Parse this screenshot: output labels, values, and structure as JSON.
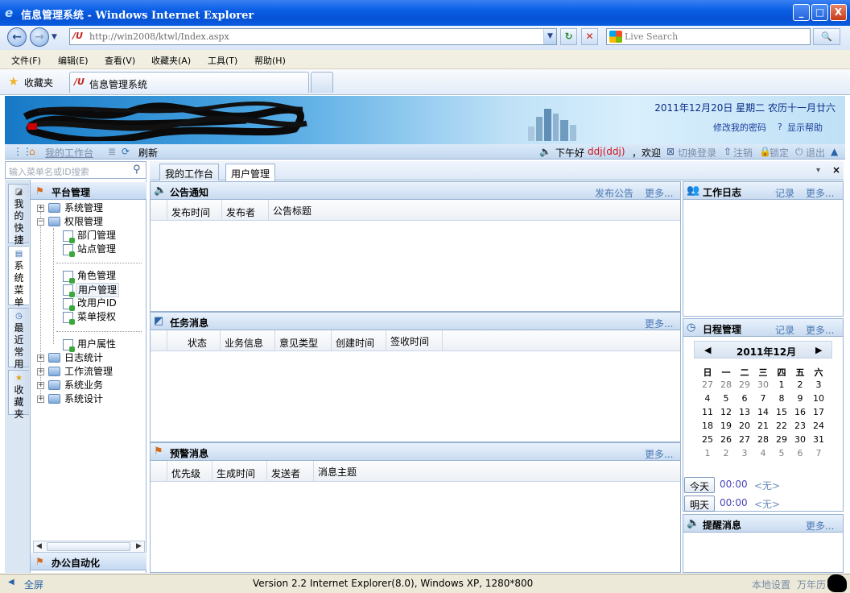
{
  "window": {
    "title": "信息管理系统 - Windows Internet Explorer",
    "minimize": "_",
    "maximize": "□",
    "close": "X"
  },
  "nav": {
    "url": "http://win2008/ktwl/Index.aspx",
    "search_placeholder": "Live Search",
    "refresh_glyph": "↻",
    "stop_glyph": "✕",
    "search_glyph": "🔍"
  },
  "menu": {
    "file": "文件(F)",
    "edit": "编辑(E)",
    "view": "查看(V)",
    "favorites": "收藏夹(A)",
    "tools": "工具(T)",
    "help": "帮助(H)"
  },
  "favbar": {
    "favorites_label": "收藏夹",
    "tab_title": "信息管理系统"
  },
  "banner": {
    "date_text": "2011年12月20日 星期二 农历十一月廿六",
    "change_password": "修改我的密码",
    "show_help": "显示帮助"
  },
  "toolbar": {
    "my_workbench": "我的工作台",
    "refresh": "刷新",
    "greeting_prefix": "下午好",
    "user": "ddj(ddj)",
    "greeting_suffix": "，欢迎",
    "switch_login": "切换登录",
    "logout": "注销",
    "lock": "锁定",
    "exit": "退出"
  },
  "left": {
    "search_placeholder": "输入菜单名或ID搜索",
    "vtabs": [
      "我的快捷",
      "系统菜单",
      "最近常用",
      "收藏夹"
    ],
    "panel_title": "平台管理",
    "bottom_panel_title": "办公自动化",
    "tree": [
      {
        "label": "系统管理",
        "type": "folder",
        "expander": "+"
      },
      {
        "label": "权限管理",
        "type": "folder",
        "expander": "−"
      },
      {
        "label": "部门管理",
        "type": "leaf"
      },
      {
        "label": "站点管理",
        "type": "leaf"
      },
      {
        "label": "角色管理",
        "type": "leaf"
      },
      {
        "label": "用户管理",
        "type": "leaf",
        "selected": true
      },
      {
        "label": "改用户ID",
        "type": "leaf"
      },
      {
        "label": "菜单授权",
        "type": "leaf"
      },
      {
        "label": "用户属性",
        "type": "leaf"
      },
      {
        "label": "日志统计",
        "type": "folder",
        "expander": "+"
      },
      {
        "label": "工作流管理",
        "type": "folder",
        "expander": "+"
      },
      {
        "label": "系统业务",
        "type": "folder",
        "expander": "+"
      },
      {
        "label": "系统设计",
        "type": "folder",
        "expander": "+"
      }
    ]
  },
  "content_tabs": [
    "我的工作台",
    "用户管理"
  ],
  "content_tab_controls": {
    "dropdown": "▾",
    "close": "×"
  },
  "announcements": {
    "title": "公告通知",
    "publish": "发布公告",
    "more": "更多...",
    "columns": [
      "发布时间",
      "发布者",
      "公告标题"
    ]
  },
  "tasks": {
    "title": "任务消息",
    "more": "更多...",
    "columns": [
      "状态",
      "业务信息",
      "意见类型",
      "创建时间",
      "签收时间"
    ]
  },
  "alerts": {
    "title": "预警消息",
    "more": "更多...",
    "columns": [
      "优先级",
      "生成时间",
      "发送者",
      "消息主题"
    ]
  },
  "worklog": {
    "title": "工作日志",
    "record": "记录",
    "more": "更多..."
  },
  "schedule": {
    "title": "日程管理",
    "record": "记录",
    "more": "更多...",
    "month_label": "2011年12月",
    "weekdays": [
      "日",
      "一",
      "二",
      "三",
      "四",
      "五",
      "六"
    ],
    "weeks": [
      [
        "27",
        "28",
        "29",
        "30",
        "1",
        "2",
        "3"
      ],
      [
        "4",
        "5",
        "6",
        "7",
        "8",
        "9",
        "10"
      ],
      [
        "11",
        "12",
        "13",
        "14",
        "15",
        "16",
        "17"
      ],
      [
        "18",
        "19",
        "20",
        "21",
        "22",
        "23",
        "24"
      ],
      [
        "25",
        "26",
        "27",
        "28",
        "29",
        "30",
        "31"
      ],
      [
        "1",
        "2",
        "3",
        "4",
        "5",
        "6",
        "7"
      ]
    ],
    "today_btn": "今天",
    "tomorrow_btn": "明天",
    "today_time": "00:00",
    "tomorrow_time": "00:00",
    "today_none": "<无>",
    "tomorrow_none": "<无>"
  },
  "reminders": {
    "title": "提醒消息",
    "more": "更多..."
  },
  "status": {
    "fullscreen": "全屏",
    "version": "Version 2.2 Internet Explorer(8.0), Windows XP, 1280*800",
    "local_settings": "本地设置",
    "calendar": "万年历"
  }
}
